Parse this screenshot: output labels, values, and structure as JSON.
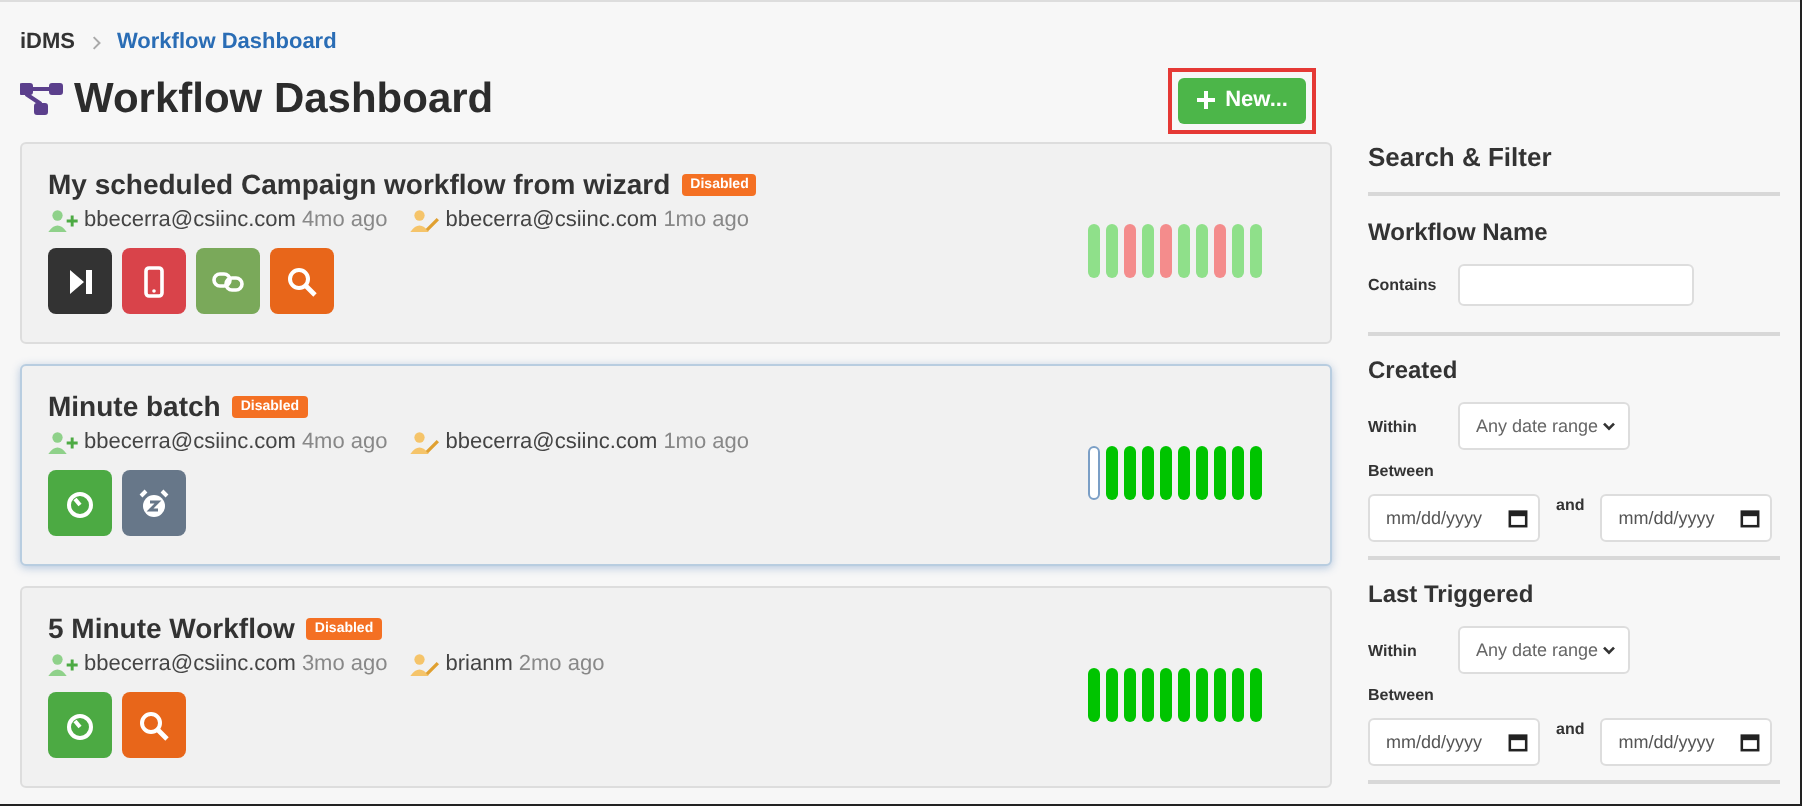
{
  "breadcrumb": [
    {
      "label": "iDMS",
      "link": false
    },
    {
      "label": "Workflow Dashboard",
      "link": true
    }
  ],
  "page_title": "Workflow Dashboard",
  "new_button": {
    "label": "New...",
    "highlighted": true
  },
  "workflows": [
    {
      "name": "My scheduled Campaign workflow from wizard",
      "status": "Disabled",
      "selected": false,
      "created_by": "bbecerra@csiinc.com",
      "created_ago": "4mo ago",
      "modified_by": "bbecerra@csiinc.com",
      "modified_ago": "1mo ago",
      "actions": [
        {
          "kind": "skip"
        },
        {
          "kind": "mobile"
        },
        {
          "kind": "link"
        },
        {
          "kind": "search"
        }
      ],
      "runs": [
        {
          "kind": "filled",
          "color": "#8fe08a"
        },
        {
          "kind": "filled",
          "color": "#8fe08a"
        },
        {
          "kind": "filled",
          "color": "#f48c8c"
        },
        {
          "kind": "filled",
          "color": "#8fe08a"
        },
        {
          "kind": "filled",
          "color": "#f48c8c"
        },
        {
          "kind": "filled",
          "color": "#8fe08a"
        },
        {
          "kind": "filled",
          "color": "#8fe08a"
        },
        {
          "kind": "filled",
          "color": "#f48c8c"
        },
        {
          "kind": "filled",
          "color": "#8fe08a"
        },
        {
          "kind": "filled",
          "color": "#8fe08a"
        }
      ]
    },
    {
      "name": "Minute batch",
      "status": "Disabled",
      "selected": true,
      "created_by": "bbecerra@csiinc.com",
      "created_ago": "4mo ago",
      "modified_by": "bbecerra@csiinc.com",
      "modified_ago": "1mo ago",
      "actions": [
        {
          "kind": "timer"
        },
        {
          "kind": "alarm"
        }
      ],
      "runs": [
        {
          "kind": "outline",
          "color": "#ffffff"
        },
        {
          "kind": "filled",
          "color": "#00c400"
        },
        {
          "kind": "filled",
          "color": "#00c400"
        },
        {
          "kind": "filled",
          "color": "#00c400"
        },
        {
          "kind": "filled",
          "color": "#00c400"
        },
        {
          "kind": "filled",
          "color": "#00c400"
        },
        {
          "kind": "filled",
          "color": "#00c400"
        },
        {
          "kind": "filled",
          "color": "#00c400"
        },
        {
          "kind": "filled",
          "color": "#00c400"
        },
        {
          "kind": "filled",
          "color": "#00c400"
        }
      ]
    },
    {
      "name": "5 Minute Workflow",
      "status": "Disabled",
      "selected": false,
      "created_by": "bbecerra@csiinc.com",
      "created_ago": "3mo ago",
      "modified_by": "brianm",
      "modified_ago": "2mo ago",
      "actions": [
        {
          "kind": "timer"
        },
        {
          "kind": "search"
        }
      ],
      "runs": [
        {
          "kind": "filled",
          "color": "#00c400"
        },
        {
          "kind": "filled",
          "color": "#00c400"
        },
        {
          "kind": "filled",
          "color": "#00c400"
        },
        {
          "kind": "filled",
          "color": "#00c400"
        },
        {
          "kind": "filled",
          "color": "#00c400"
        },
        {
          "kind": "filled",
          "color": "#00c400"
        },
        {
          "kind": "filled",
          "color": "#00c400"
        },
        {
          "kind": "filled",
          "color": "#00c400"
        },
        {
          "kind": "filled",
          "color": "#00c400"
        },
        {
          "kind": "filled",
          "color": "#00c400"
        }
      ]
    }
  ],
  "filter": {
    "title": "Search & Filter",
    "sections": [
      {
        "title": "Workflow Name",
        "fields": [
          {
            "kind": "text",
            "label": "Contains"
          }
        ]
      },
      {
        "title": "Created",
        "fields": [
          {
            "kind": "select",
            "label": "Within",
            "value": "Any date range"
          },
          {
            "kind": "range",
            "label": "Between",
            "from_placeholder": "mm/dd/yyyy",
            "joiner": "and",
            "to_placeholder": "mm/dd/yyyy"
          }
        ]
      },
      {
        "title": "Last Triggered",
        "fields": [
          {
            "kind": "select",
            "label": "Within",
            "value": "Any date range"
          },
          {
            "kind": "range",
            "label": "Between",
            "from_placeholder": "mm/dd/yyyy",
            "joiner": "and",
            "to_placeholder": "mm/dd/yyyy"
          }
        ]
      }
    ]
  }
}
